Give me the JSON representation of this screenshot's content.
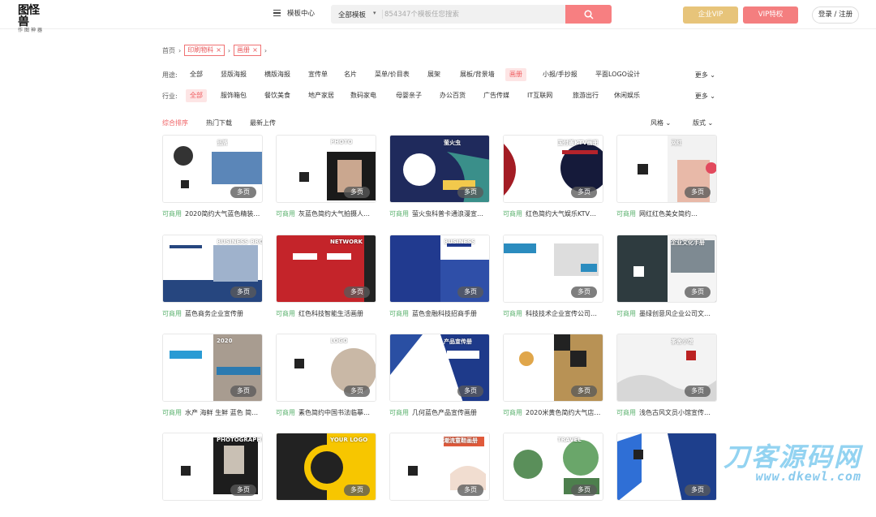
{
  "header": {
    "logo_main": "图怪兽",
    "logo_sub": "作图神器",
    "template_center": "模板中心",
    "search_category": "全部模板",
    "search_placeholder": "854347个模板任您搜索",
    "vip_enterprise": "企业VIP",
    "vip_special": "VIP特权",
    "login": "登录 / 注册"
  },
  "breadcrumb": {
    "home": "首页",
    "tags": [
      "印刷物料",
      "画册"
    ]
  },
  "filters": {
    "usage_label": "用途:",
    "usage_options": [
      "全部",
      "竖版海报",
      "横版海报",
      "宣传单",
      "名片",
      "菜单/价目表",
      "展架",
      "展板/背景墙",
      "画册",
      "小报/手抄报",
      "平面LOGO设计"
    ],
    "usage_active": 8,
    "industry_label": "行业:",
    "industry_options": [
      "全部",
      "服饰箱包",
      "餐饮美食",
      "地产家居",
      "数码家电",
      "母婴亲子",
      "办公百货",
      "广告传媒",
      "IT互联网",
      "旅游出行",
      "休闲娱乐"
    ],
    "industry_active": 0,
    "more": "更多"
  },
  "sort": {
    "options": [
      "综合排序",
      "热门下载",
      "最新上传"
    ],
    "active": 0,
    "style": "风格",
    "layout": "版式"
  },
  "card_badge": "多页",
  "commercial_label": "可商用",
  "cards": [
    {
      "title": "2020简约大气蓝色精装…",
      "thumb_text": "品牌"
    },
    {
      "title": "灰蓝色简约大气拍摄人…",
      "thumb_text": "PHOTO"
    },
    {
      "title": "萤火虫科普卡通浪漫宣…",
      "thumb_text": "萤火虫"
    },
    {
      "title": "红色简约大气娱乐KTV…",
      "thumb_text": "国付善KTV画册"
    },
    {
      "title": "网红红色美女简约…",
      "thumb_text": "网红"
    },
    {
      "title": "蓝色商务企业宣传册",
      "thumb_text": "BUSINESS BROCHURE"
    },
    {
      "title": "红色科技智能生活画册",
      "thumb_text": "NETWORK"
    },
    {
      "title": "蓝色金融科技招商手册",
      "thumb_text": "BUSINESS"
    },
    {
      "title": "科技技术企业宣传公司…",
      "thumb_text": ""
    },
    {
      "title": "墨绿创意风企业公司文…",
      "thumb_text": "企业文化手册"
    },
    {
      "title": "水产 海鲜 生鲜 蓝色 简…",
      "thumb_text": "2020"
    },
    {
      "title": "素色简约中国书法临摹…",
      "thumb_text": "LOGO"
    },
    {
      "title": "几何蓝色产品宣传画册",
      "thumb_text": "产品宣传册"
    },
    {
      "title": "2020米黄色简约大气店…",
      "thumb_text": ""
    },
    {
      "title": "浅色古风文员小馆宣传…",
      "thumb_text": "茶舍小馆"
    },
    {
      "title": "",
      "thumb_text": "PHOTOGRAPHY"
    },
    {
      "title": "",
      "thumb_text": "YOUR LOGO"
    },
    {
      "title": "",
      "thumb_text": "潮流童鞋画册"
    },
    {
      "title": "",
      "thumb_text": "TRAVEL"
    },
    {
      "title": "",
      "thumb_text": ""
    }
  ],
  "watermark": {
    "main": "刀客源码网",
    "url": "www.dkewl.com"
  },
  "colors": {
    "accent": "#ef5b5e",
    "commercial": "#5ab16d",
    "gold": "#e7c47a"
  }
}
